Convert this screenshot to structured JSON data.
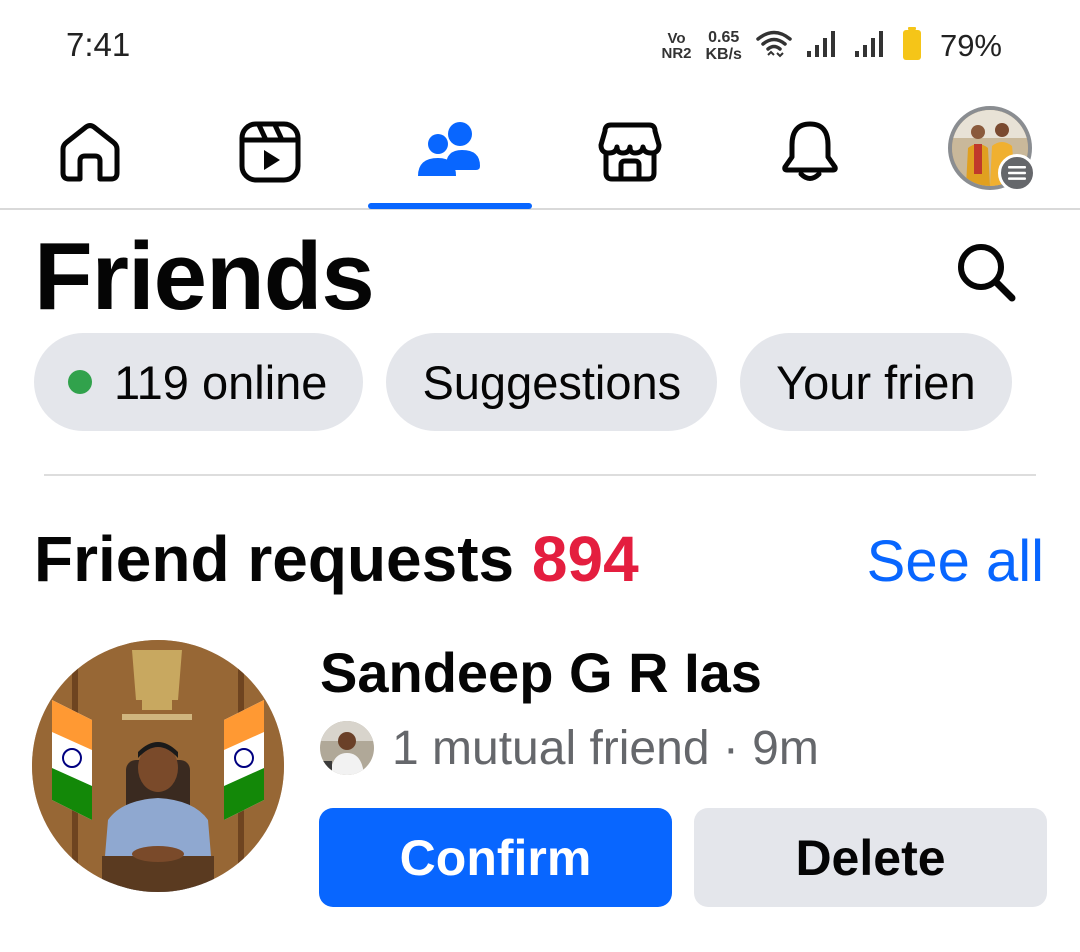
{
  "status_bar": {
    "time": "7:41",
    "volte_top": "Vo",
    "volte_bottom": "NR2",
    "speed_value": "0.65",
    "speed_unit": "KB/s",
    "battery": "79%",
    "battery_color": "#f5c518"
  },
  "nav": {
    "tabs": [
      {
        "icon": "home-icon"
      },
      {
        "icon": "reels-icon"
      },
      {
        "icon": "friends-icon",
        "active": true
      },
      {
        "icon": "marketplace-icon"
      },
      {
        "icon": "notifications-bell-icon"
      },
      {
        "icon": "profile-menu-icon"
      }
    ],
    "active_color": "#0866ff"
  },
  "header": {
    "title": "Friends"
  },
  "chips": {
    "online": "119 online",
    "suggestions": "Suggestions",
    "your_friends": "Your frien"
  },
  "requests": {
    "title": "Friend requests",
    "count": "894",
    "count_color": "#e41e3f",
    "see_all": "See all",
    "items": [
      {
        "name": "Sandeep G R Ias",
        "mutual": "1 mutual friend · 9m",
        "confirm_label": "Confirm",
        "delete_label": "Delete"
      }
    ]
  }
}
